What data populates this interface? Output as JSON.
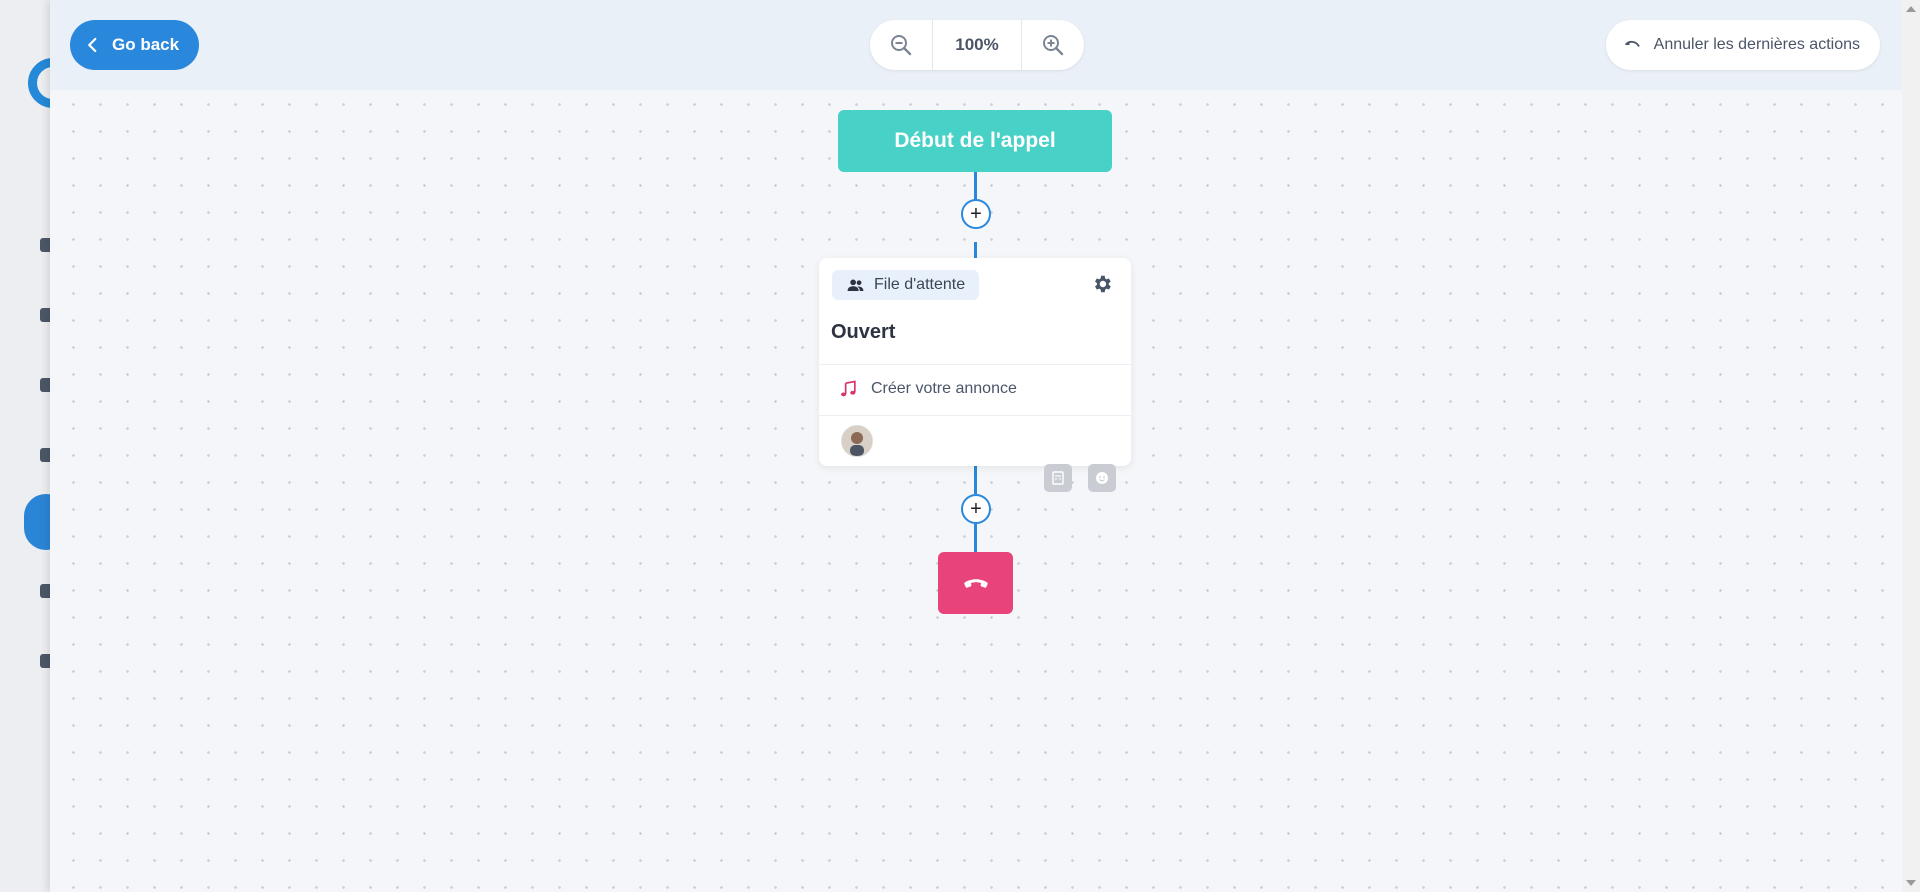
{
  "toolbar": {
    "back_label": "Go back",
    "zoom_level": "100%",
    "undo_label": "Annuler les dernières actions"
  },
  "flow": {
    "start_label": "Début de l'appel",
    "queue_card": {
      "badge_label": "File d'attente",
      "title": "Ouvert",
      "announcement_label": "Créer votre annonce"
    }
  },
  "icons": {
    "back": "chevron-left-icon",
    "zoom_out": "zoom-out-icon",
    "zoom_in": "zoom-in-icon",
    "undo": "undo-icon",
    "queue": "users-icon",
    "settings": "gear-icon",
    "music": "music-note-icon",
    "hangup": "phone-hangup-icon"
  },
  "colors": {
    "primary": "#2a88dc",
    "start_node": "#48d1c6",
    "hangup": "#e8437a",
    "music_note": "#d6336c"
  }
}
